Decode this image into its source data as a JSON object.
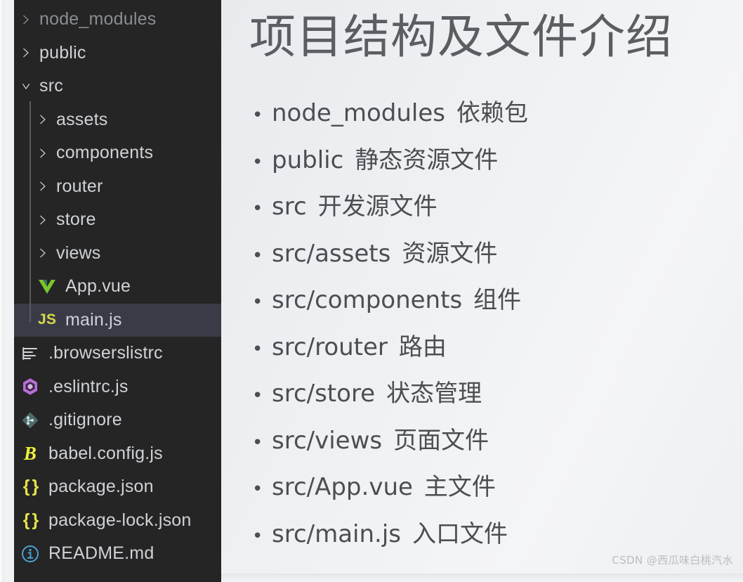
{
  "explorer": {
    "selected_file": "main.js",
    "items": [
      {
        "label": "node_modules",
        "type": "folder",
        "depth": 1,
        "expanded": false,
        "dim": true,
        "icon": "chevron-right-icon"
      },
      {
        "label": "public",
        "type": "folder",
        "depth": 1,
        "expanded": false,
        "dim": false,
        "icon": "chevron-right-icon"
      },
      {
        "label": "src",
        "type": "folder",
        "depth": 1,
        "expanded": true,
        "dim": false,
        "icon": "chevron-down-icon"
      },
      {
        "label": "assets",
        "type": "folder",
        "depth": 2,
        "expanded": false,
        "dim": false,
        "icon": "chevron-right-icon"
      },
      {
        "label": "components",
        "type": "folder",
        "depth": 2,
        "expanded": false,
        "dim": false,
        "icon": "chevron-right-icon"
      },
      {
        "label": "router",
        "type": "folder",
        "depth": 2,
        "expanded": false,
        "dim": false,
        "icon": "chevron-right-icon"
      },
      {
        "label": "store",
        "type": "folder",
        "depth": 2,
        "expanded": false,
        "dim": false,
        "icon": "chevron-right-icon"
      },
      {
        "label": "views",
        "type": "folder",
        "depth": 2,
        "expanded": false,
        "dim": false,
        "icon": "chevron-right-icon"
      },
      {
        "label": "App.vue",
        "type": "file",
        "depth": 2,
        "icon": "vue-file-icon",
        "selected": false
      },
      {
        "label": "main.js",
        "type": "file",
        "depth": 2,
        "icon": "js-file-icon",
        "selected": true
      },
      {
        "label": ".browserslistrc",
        "type": "file",
        "depth": 1,
        "icon": "config-lines-file-icon",
        "selected": false
      },
      {
        "label": ".eslintrc.js",
        "type": "file",
        "depth": 1,
        "icon": "eslint-file-icon",
        "selected": false
      },
      {
        "label": ".gitignore",
        "type": "file",
        "depth": 1,
        "icon": "git-file-icon",
        "selected": false
      },
      {
        "label": "babel.config.js",
        "type": "file",
        "depth": 1,
        "icon": "babel-file-icon",
        "selected": false
      },
      {
        "label": "package.json",
        "type": "file",
        "depth": 1,
        "icon": "json-file-icon",
        "selected": false
      },
      {
        "label": "package-lock.json",
        "type": "file",
        "depth": 1,
        "icon": "json-file-icon",
        "selected": false
      },
      {
        "label": "README.md",
        "type": "file",
        "depth": 1,
        "icon": "info-markdown-file-icon",
        "selected": false
      }
    ]
  },
  "slide": {
    "title": "项目结构及文件介绍",
    "bullets": [
      {
        "path": "node_modules",
        "desc": "依赖包"
      },
      {
        "path": "public",
        "desc": "静态资源文件"
      },
      {
        "path": "src",
        "desc": "开发源文件"
      },
      {
        "path": "src/assets",
        "desc": "资源文件"
      },
      {
        "path": "src/components",
        "desc": "组件"
      },
      {
        "path": "src/router",
        "desc": "路由"
      },
      {
        "path": "src/store",
        "desc": "状态管理"
      },
      {
        "path": "src/views",
        "desc": "页面文件"
      },
      {
        "path": "src/App.vue",
        "desc": "主文件"
      },
      {
        "path": "src/main.js",
        "desc": "入口文件"
      }
    ],
    "bullet_marker": "•",
    "watermark": "CSDN @西瓜味白桃汽水"
  },
  "colors": {
    "explorer_bg": "#252526",
    "explorer_selected_bg": "#3a3b46",
    "explorer_text": "#cfd2d6",
    "explorer_text_dim": "#8a8d92",
    "slide_bg": "#eef0f2",
    "slide_title_text": "#5a5e62",
    "slide_body_text": "#4b4e52",
    "vue_green": "#41b883",
    "vue_green_light": "#7bc62d",
    "js_yellow": "#d7d94b",
    "json_yellow": "#e3e34a",
    "babel_yellow": "#f0f03c",
    "eslint_purple": "#b86fd6",
    "git_gray": "#4f6a6a",
    "readme_blue": "#4aa3d6",
    "watermark_text": "#b9bec3"
  }
}
